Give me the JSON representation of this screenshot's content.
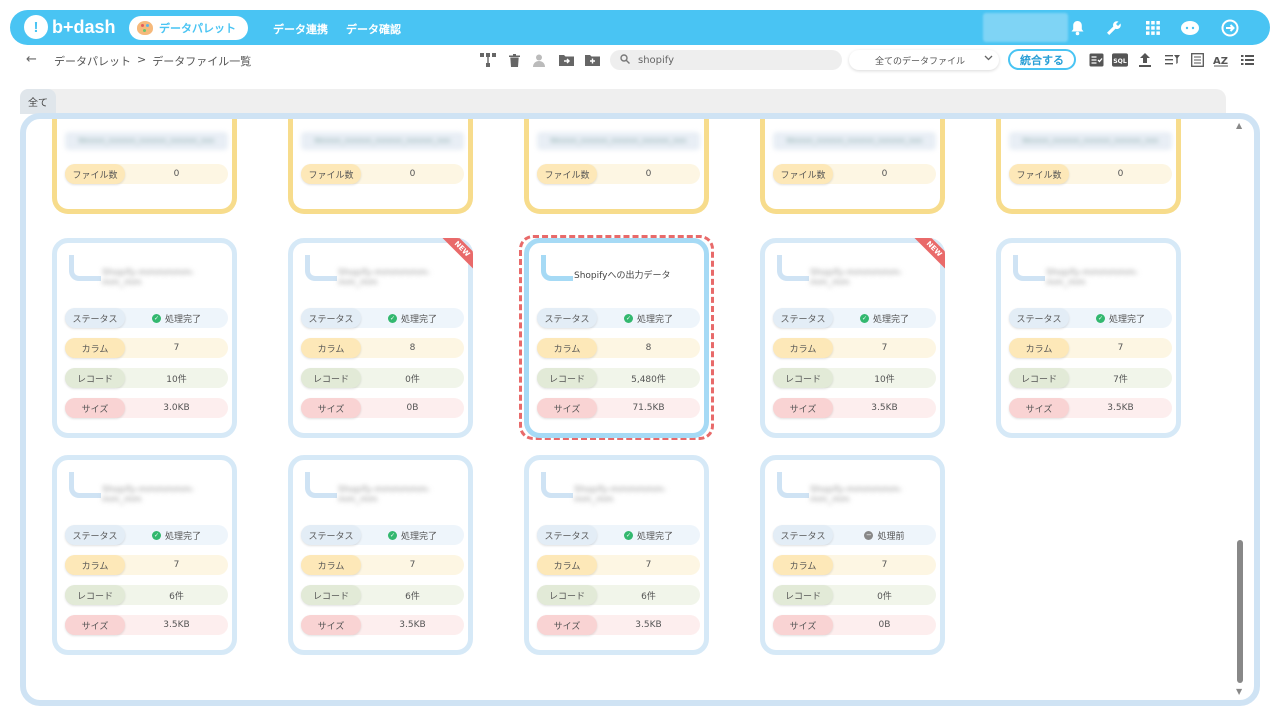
{
  "app": {
    "logo_text": "b+dash",
    "nav_active": "データパレット",
    "nav_links": [
      "データ連携",
      "データ確認"
    ]
  },
  "toolbar": {
    "back": "←",
    "breadcrumb": [
      "データパレット",
      ">",
      "データファイル一覧"
    ],
    "search_value": "shopify",
    "select_value": "全てのデータファイル",
    "merge_label": "統合する"
  },
  "tabs": {
    "all": "全て"
  },
  "labels": {
    "status": "ステータス",
    "column": "カラム",
    "record": "レコード",
    "size": "サイズ",
    "file_count": "ファイル数",
    "new": "NEW"
  },
  "yellow_cards": [
    {
      "name": "Mmmm_mmmm_mmmm_mmmm_mm",
      "file_count": "0"
    },
    {
      "name": "Mmmm_mmmm_mmmm_mmmm_mm",
      "file_count": "0"
    },
    {
      "name": "Mmmm_mmmm_mmmm_mmmm_mm",
      "file_count": "0"
    },
    {
      "name": "Mmmm_mmmm_mmmm_mmmm_mm",
      "file_count": "0"
    },
    {
      "name": "Mmmm_mmmm_mmmm_mmmm_mm",
      "file_count": "0"
    }
  ],
  "cards": [
    {
      "title": "Shopify-mmmmmm-mm_mm",
      "blurred": true,
      "new": false,
      "status": "処理完了",
      "done": true,
      "columns": "7",
      "records": "10件",
      "size": "3.0KB"
    },
    {
      "title": "Shopify-mmmmmm-mm_mm",
      "blurred": true,
      "new": true,
      "status": "処理完了",
      "done": true,
      "columns": "8",
      "records": "0件",
      "size": "0B"
    },
    {
      "title": "Shopifyへの出力データ",
      "blurred": false,
      "new": false,
      "highlight": true,
      "status": "処理完了",
      "done": true,
      "columns": "8",
      "records": "5,480件",
      "size": "71.5KB"
    },
    {
      "title": "Shopify-mmmmmm-mm_mm",
      "blurred": true,
      "new": true,
      "status": "処理完了",
      "done": true,
      "columns": "7",
      "records": "10件",
      "size": "3.5KB"
    },
    {
      "title": "Shopify-mmmmmm-mm_mm",
      "blurred": true,
      "new": false,
      "status": "処理完了",
      "done": true,
      "columns": "7",
      "records": "7件",
      "size": "3.5KB"
    },
    {
      "title": "Shopify-mmmmmm-mm_mm",
      "blurred": true,
      "new": false,
      "status": "処理完了",
      "done": true,
      "columns": "7",
      "records": "6件",
      "size": "3.5KB"
    },
    {
      "title": "Shopify-mmmmmm-mm_mm",
      "blurred": true,
      "new": false,
      "status": "処理完了",
      "done": true,
      "columns": "7",
      "records": "6件",
      "size": "3.5KB"
    },
    {
      "title": "Shopify-mmmmmm-mm_mm",
      "blurred": true,
      "new": false,
      "status": "処理完了",
      "done": true,
      "columns": "7",
      "records": "6件",
      "size": "3.5KB"
    },
    {
      "title": "Shopify-mmmmmm-mm_mm",
      "blurred": true,
      "new": false,
      "status": "処理前",
      "done": false,
      "columns": "7",
      "records": "0件",
      "size": "0B"
    }
  ]
}
